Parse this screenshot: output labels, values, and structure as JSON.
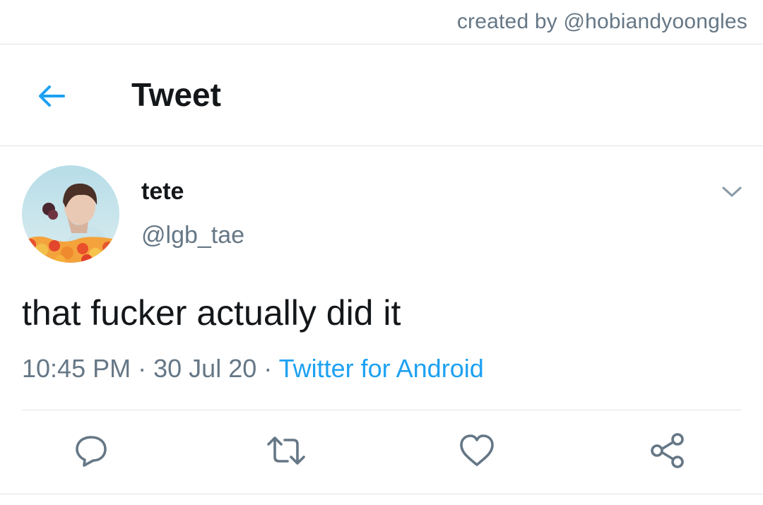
{
  "credit": "created by @hobiandyoongles",
  "header": {
    "back_icon": "arrow-left-icon",
    "title": "Tweet"
  },
  "tweet": {
    "display_name": "tete",
    "handle": "@lgb_tae",
    "text": "that fucker actually did it",
    "time": "10:45 PM",
    "date": "30 Jul 20",
    "separator": "·",
    "source": "Twitter for Android",
    "menu_icon": "chevron-down-icon"
  },
  "actions": [
    {
      "name": "reply",
      "icon": "speech-bubble-icon"
    },
    {
      "name": "retweet",
      "icon": "retweet-arrows-icon"
    },
    {
      "name": "like",
      "icon": "heart-icon"
    },
    {
      "name": "share",
      "icon": "share-nodes-icon"
    }
  ],
  "colors": {
    "accent": "#1da1f2",
    "text_primary": "#14171a",
    "text_secondary": "#657786",
    "divider": "#dfe3e6"
  }
}
